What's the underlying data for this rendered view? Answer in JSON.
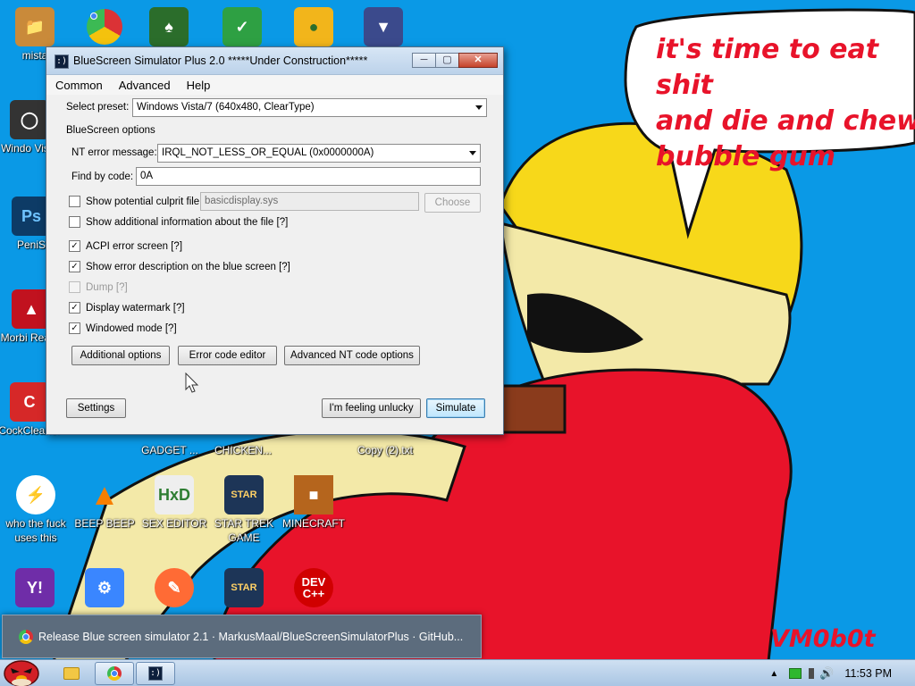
{
  "desktop": {
    "speech_lines": [
      "it's time to eat shit",
      "and die and chew",
      "bubble gum"
    ],
    "signature": "VM0b0t",
    "icons": [
      {
        "label": "mista",
        "icon": "user-folder-icon",
        "color": "#c98a3a"
      },
      {
        "label": "",
        "icon": "chrome-icon",
        "color": "#db3236"
      },
      {
        "label": "",
        "icon": "solitaire-icon",
        "color": "#2b6d2b"
      },
      {
        "label": "",
        "icon": "shield-icon",
        "color": "#2ea043"
      },
      {
        "label": "",
        "icon": "bad-piggies-icon",
        "color": "#f2b51b"
      },
      {
        "label": "",
        "icon": "emblem-icon",
        "color": "#3b4a8c"
      },
      {
        "label": "Windo Vista",
        "icon": "trash-icon",
        "color": "#333333"
      },
      {
        "label": "PeniS",
        "icon": "photoshop-icon",
        "color": "#0d3b66"
      },
      {
        "label": "Morbi Reade",
        "icon": "pdf-icon",
        "color": "#c1121f"
      },
      {
        "label": "CockCleaner",
        "icon": "broom-icon",
        "color": "#d62828"
      },
      {
        "label": "who the fuck uses this",
        "icon": "bolt-icon",
        "color": "#ffffff"
      },
      {
        "label": "BEEP BEEP",
        "icon": "cone-icon",
        "color": "#f77f00"
      },
      {
        "label": "SEX EDITOR",
        "icon": "hxd-icon",
        "color": "#eeeeee"
      },
      {
        "label": "STAR TREK GAME",
        "icon": "star-wars-icon",
        "color": "#1d3557"
      },
      {
        "label": "MINECRAFT",
        "icon": "minecraft-icon",
        "color": "#b5651d"
      },
      {
        "label": "",
        "icon": "yahoo-icon",
        "color": "#6f2da8"
      },
      {
        "label": "",
        "icon": "settings-icon",
        "color": "#3a86ff"
      },
      {
        "label": "",
        "icon": "paint-icon",
        "color": "#ff6b35"
      },
      {
        "label": "",
        "icon": "star-wars-icon",
        "color": "#1d3557"
      },
      {
        "label": "DEV C++",
        "icon": "devcpp-icon",
        "color": "#d00000"
      }
    ],
    "partial_labels": {
      "gadget": "GADGET ...",
      "chicken": "CHICKEN...",
      "copy_txt": "Copy (2).txt"
    }
  },
  "window": {
    "title": "BlueScreen Simulator Plus 2.0 *****Under Construction*****",
    "app_icon_glyph": ":)",
    "menu": [
      "Common",
      "Advanced",
      "Help"
    ],
    "preset_label": "Select preset:",
    "preset_value": "Windows Vista/7 (640x480, ClearType)",
    "section_label": "BlueScreen options",
    "nt_error_label": "NT error message:",
    "nt_error_value": "IRQL_NOT_LESS_OR_EQUAL (0x0000000A)",
    "find_by_code_label": "Find by code:",
    "find_by_code_value": "0A",
    "culprit_label": "Show potential culprit file",
    "culprit_value": "basicdisplay.sys",
    "choose_label": "Choose",
    "checkboxes": [
      {
        "label": "Show additional information about the file [?]",
        "checked": false,
        "enabled": true
      },
      {
        "label": "ACPI error screen [?]",
        "checked": true,
        "enabled": true
      },
      {
        "label": "Show error description on the blue screen [?]",
        "checked": true,
        "enabled": true
      },
      {
        "label": "Dump [?]",
        "checked": false,
        "enabled": false
      },
      {
        "label": "Display watermark [?]",
        "checked": true,
        "enabled": true
      },
      {
        "label": "Windowed mode [?]",
        "checked": true,
        "enabled": true
      }
    ],
    "buttons": {
      "additional_options": "Additional options",
      "error_code_editor": "Error code editor",
      "advanced_nt": "Advanced NT code options",
      "settings": "Settings",
      "feeling_unlucky": "I'm feeling unlucky",
      "simulate": "Simulate"
    }
  },
  "preview_tooltip": "Release Blue screen simulator 2.1 · MarkusMaal/BlueScreenSimulatorPlus · GitHub...",
  "taskbar": {
    "clock": "11:53 PM"
  },
  "colors": {
    "desktop_bg": "#0a99e6",
    "speech_text": "#e8132a",
    "figure_red": "#e8132a",
    "figure_yellow": "#f7d81a",
    "figure_skin": "#f3e9a8"
  }
}
